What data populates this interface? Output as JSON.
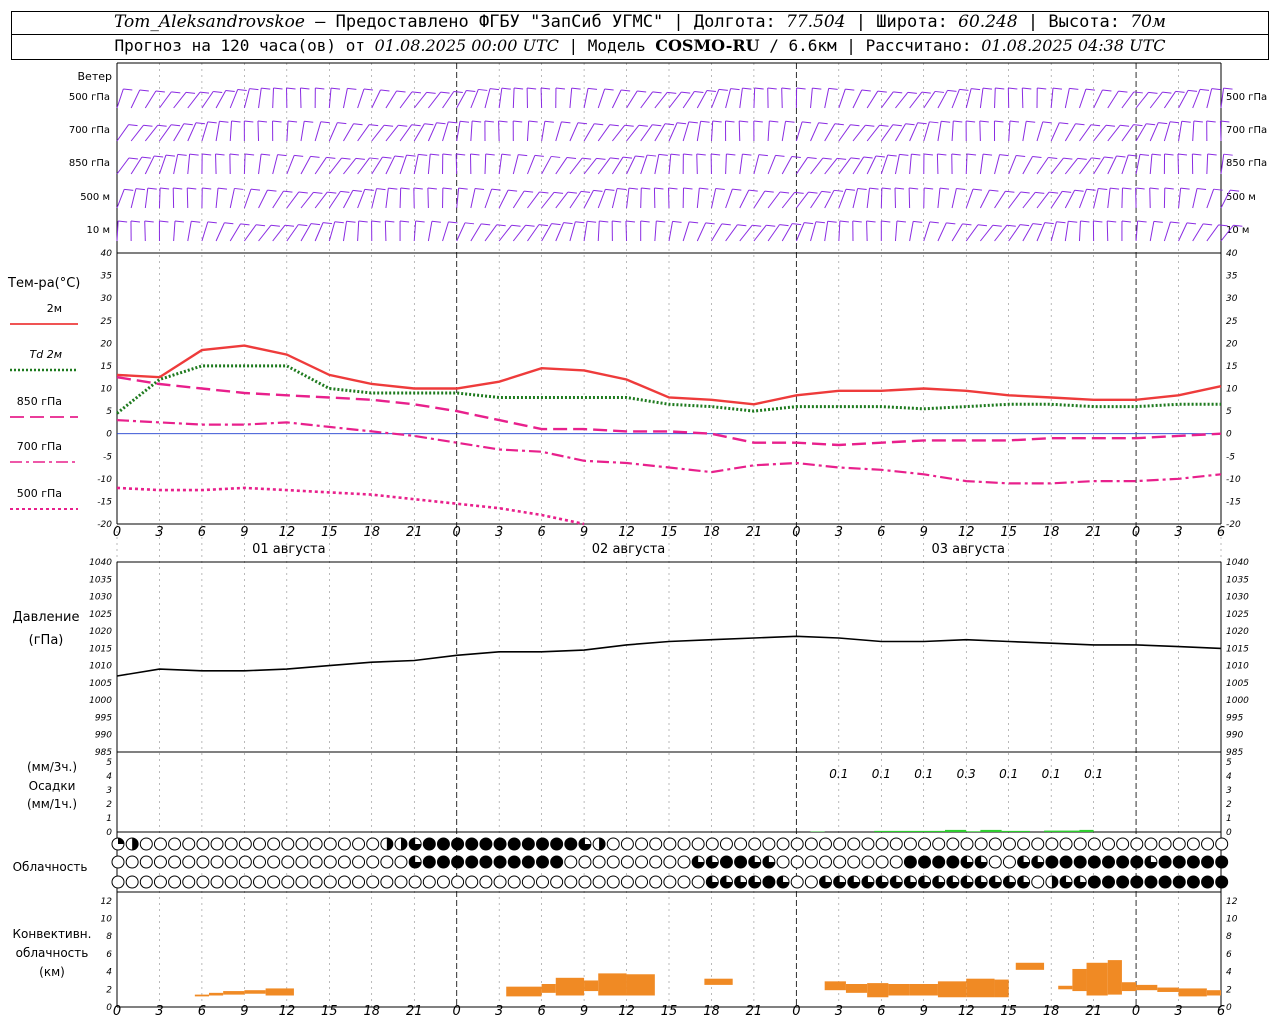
{
  "header": {
    "station": "Tom_Aleksandrovskoe",
    "dash": "—",
    "provider": "Предоставлено ФГБУ \"ЗапСиб УГМС\"",
    "lon_label": "Долгота:",
    "lon_value": "77.504",
    "lat_label": "Широта:",
    "lat_value": "60.248",
    "alt_label": "Высота:",
    "alt_value": "70м",
    "forecast_prefix": "Прогноз на 120 часа(ов) от",
    "forecast_start": "01.08.2025 00:00 UTC",
    "model_label": "Модель",
    "model_name": "COSMO-RU",
    "model_res": "/ 6.6км",
    "computed_label": "Рассчитано:",
    "computed_time": "01.08.2025 04:38 UTC"
  },
  "colors": {
    "wind": "#8a2be2",
    "t2m": "#ee3b3b",
    "td2m": "#1e7a1e",
    "t850": "#e8208c",
    "t700": "#e8208c",
    "t500": "#e8208c",
    "zero_line": "#1f3fcf",
    "pressure": "#000000",
    "precip": "#2ecc2e",
    "convective": "#f08a24",
    "grid": "#000000"
  },
  "x_axis": {
    "hours": [
      "0",
      "3",
      "6",
      "9",
      "12",
      "15",
      "18",
      "21",
      "0",
      "3",
      "6",
      "9",
      "12",
      "15",
      "18",
      "21",
      "0",
      "3",
      "6",
      "9",
      "12",
      "15",
      "18",
      "21",
      "0",
      "3",
      "6"
    ],
    "dates": [
      "01 августа",
      "02 августа",
      "03 августа"
    ]
  },
  "wind_panel": {
    "title": "Ветер",
    "levels": [
      "500 гПа",
      "700 гПа",
      "850 гПа",
      "500 м",
      "10  м"
    ]
  },
  "chart_data": [
    {
      "type": "line",
      "panel": "temperature",
      "title": "Тем-ра(°C)",
      "ylim": [
        -20,
        40
      ],
      "yticks": [
        "40",
        "35",
        "30",
        "25",
        "20",
        "15",
        "10",
        "5",
        "0",
        "-5",
        "-10",
        "-15",
        "-20"
      ],
      "x_hours": [
        0,
        3,
        6,
        9,
        12,
        15,
        18,
        21,
        24,
        27,
        30,
        33,
        36,
        39,
        42,
        45,
        48,
        51,
        54,
        57,
        60,
        63,
        66,
        69,
        72,
        75,
        78
      ],
      "series": [
        {
          "name": "2м",
          "style": "solid",
          "values": [
            13,
            12.5,
            18.5,
            19.5,
            17.5,
            13,
            11,
            10,
            10,
            11.5,
            14.5,
            14,
            12,
            8,
            7.5,
            6.5,
            8.5,
            9.5,
            9.5,
            10,
            9.5,
            8.5,
            8,
            7.5,
            7.5,
            8.5,
            10.5
          ]
        },
        {
          "name": "Td  2м",
          "style": "dotted",
          "values": [
            4.5,
            12,
            15,
            15,
            15,
            10,
            9,
            9,
            9,
            8,
            8,
            8,
            8,
            6.5,
            6,
            5,
            6,
            6,
            6,
            5.5,
            6,
            6.5,
            6.5,
            6,
            6,
            6.5,
            6.5
          ]
        },
        {
          "name": "850  гПа",
          "style": "dash",
          "values": [
            12.5,
            11,
            10,
            9,
            8.5,
            8,
            7.5,
            6.5,
            5,
            3,
            1,
            1,
            0.5,
            0.5,
            0,
            -2,
            -2,
            -2.5,
            -2,
            -1.5,
            -1.5,
            -1.5,
            -1,
            -1,
            -1,
            -0.5,
            0
          ]
        },
        {
          "name": "700  гПа",
          "style": "dashdot",
          "values": [
            3,
            2.5,
            2,
            2,
            2.5,
            1.5,
            0.5,
            -0.5,
            -2,
            -3.5,
            -4,
            -6,
            -6.5,
            -7.5,
            -8.5,
            -7,
            -6.5,
            -7.5,
            -8,
            -9,
            -10.5,
            -11,
            -11,
            -10.5,
            -10.5,
            -10,
            -9
          ]
        },
        {
          "name": "500  гПа",
          "style": "fine-dash",
          "values": [
            -12,
            -12.5,
            -12.5,
            -12,
            -12.5,
            -13,
            -13.5,
            -14.5,
            -15.5,
            -16.5,
            -18,
            -20,
            null,
            null,
            null,
            null,
            null,
            null,
            null,
            null,
            null,
            null,
            null,
            null,
            null,
            null,
            null
          ]
        }
      ]
    },
    {
      "type": "line",
      "panel": "pressure",
      "title": "Давление",
      "ylabel": "(гПа)",
      "ylim": [
        985,
        1040
      ],
      "yticks": [
        "1040",
        "1035",
        "1030",
        "1025",
        "1020",
        "1015",
        "1010",
        "1005",
        "1000",
        "995",
        "990",
        "985"
      ],
      "x_hours": [
        0,
        3,
        6,
        9,
        12,
        15,
        18,
        21,
        24,
        27,
        30,
        33,
        36,
        39,
        42,
        45,
        48,
        51,
        54,
        57,
        60,
        63,
        66,
        69,
        72,
        75,
        78
      ],
      "series": [
        {
          "name": "pressure",
          "values": [
            1007,
            1009,
            1008.5,
            1008.5,
            1009,
            1010,
            1011,
            1011.5,
            1013,
            1014,
            1014,
            1014.5,
            1016,
            1017,
            1017.5,
            1018,
            1018.5,
            1018,
            1017,
            1017,
            1017.5,
            1017,
            1016.5,
            1016,
            1016,
            1015.5,
            1015
          ]
        }
      ]
    },
    {
      "type": "bar",
      "panel": "precipitation",
      "title": "Осадки",
      "ylabel_top": "(мм/3ч.)",
      "ylabel_bottom": "(мм/1ч.)",
      "ylim": [
        0,
        5
      ],
      "yticks": [
        "5",
        "4",
        "3",
        "2",
        "1",
        "0"
      ],
      "labels": [
        {
          "x": 51,
          "text": "0.1"
        },
        {
          "x": 54,
          "text": "0.1"
        },
        {
          "x": 57,
          "text": "0.1"
        },
        {
          "x": 60,
          "text": "0.3"
        },
        {
          "x": 63,
          "text": "0.1"
        },
        {
          "x": 66,
          "text": "0.1"
        },
        {
          "x": 69,
          "text": "0.1"
        }
      ],
      "bars": [
        {
          "x0": 49,
          "x1": 50,
          "value": 0.03
        },
        {
          "x0": 53.5,
          "x1": 58.5,
          "value": 0.08
        },
        {
          "x0": 58.5,
          "x1": 60,
          "value": 0.15
        },
        {
          "x0": 60,
          "x1": 61,
          "value": 0.05
        },
        {
          "x0": 61,
          "x1": 62.5,
          "value": 0.15
        },
        {
          "x0": 62.5,
          "x1": 64.5,
          "value": 0.08
        },
        {
          "x0": 65.5,
          "x1": 68,
          "value": 0.1
        },
        {
          "x0": 68,
          "x1": 69,
          "value": 0.15
        }
      ]
    },
    {
      "type": "table",
      "panel": "cloudiness",
      "title": "Облачность",
      "rows": [
        [
          1,
          2,
          0,
          0,
          0,
          0,
          0,
          0,
          0,
          0,
          0,
          0,
          0,
          0,
          0,
          0,
          0,
          0,
          0,
          2,
          2,
          3,
          4,
          4,
          4,
          4,
          4,
          4,
          4,
          4,
          4,
          4,
          4,
          3,
          2,
          0,
          0,
          0,
          0,
          0,
          0,
          0,
          0,
          0,
          0,
          0,
          0,
          0,
          0,
          0,
          0,
          0,
          0,
          0,
          0,
          0,
          0,
          0,
          0,
          0,
          0,
          0,
          0,
          0,
          0,
          0,
          0,
          0,
          0,
          0,
          0,
          0,
          0,
          0,
          0,
          0,
          0,
          0,
          0
        ],
        [
          0,
          0,
          0,
          0,
          0,
          0,
          0,
          0,
          0,
          0,
          0,
          0,
          0,
          0,
          0,
          0,
          0,
          0,
          0,
          0,
          0,
          3,
          4,
          4,
          4,
          4,
          4,
          4,
          4,
          4,
          4,
          4,
          0,
          0,
          0,
          0,
          0,
          0,
          0,
          0,
          0,
          3,
          3,
          4,
          4,
          3,
          3,
          0,
          0,
          0,
          0,
          0,
          0,
          0,
          0,
          0,
          4,
          4,
          4,
          4,
          3,
          3,
          0,
          0,
          3,
          3,
          4,
          4,
          4,
          4,
          4,
          4,
          4,
          3,
          4,
          4,
          4,
          4,
          4
        ],
        [
          0,
          0,
          0,
          0,
          0,
          0,
          0,
          0,
          0,
          0,
          0,
          0,
          0,
          0,
          0,
          0,
          0,
          0,
          0,
          0,
          0,
          0,
          0,
          0,
          0,
          0,
          0,
          0,
          0,
          0,
          0,
          0,
          0,
          0,
          0,
          0,
          0,
          0,
          0,
          0,
          0,
          0,
          3,
          3,
          3,
          3,
          4,
          3,
          0,
          0,
          3,
          3,
          3,
          3,
          3,
          3,
          3,
          3,
          3,
          3,
          3,
          3,
          3,
          3,
          3,
          0,
          2,
          3,
          3,
          4,
          4,
          4,
          4,
          4,
          4,
          4,
          4,
          4,
          4
        ]
      ]
    },
    {
      "type": "bar",
      "panel": "convective",
      "title": "Конвективн.",
      "subtitle": "облачность",
      "ylabel": "(км)",
      "ylim": [
        0,
        13
      ],
      "yticks": [
        "12",
        "10",
        "8",
        "6",
        "4",
        "2",
        "0"
      ],
      "bars": [
        {
          "x0": 5.5,
          "x1": 6.5,
          "base": 1.2,
          "top": 1.4
        },
        {
          "x0": 6.5,
          "x1": 7.5,
          "base": 1.3,
          "top": 1.6
        },
        {
          "x0": 7.5,
          "x1": 9,
          "base": 1.4,
          "top": 1.8
        },
        {
          "x0": 9,
          "x1": 10.5,
          "base": 1.5,
          "top": 1.9
        },
        {
          "x0": 10.5,
          "x1": 12.5,
          "base": 1.3,
          "top": 2.1
        },
        {
          "x0": 27.5,
          "x1": 30,
          "base": 1.2,
          "top": 2.3
        },
        {
          "x0": 30,
          "x1": 31,
          "base": 1.6,
          "top": 2.6
        },
        {
          "x0": 31,
          "x1": 33,
          "base": 1.3,
          "top": 3.3
        },
        {
          "x0": 33,
          "x1": 34,
          "base": 1.8,
          "top": 3.0
        },
        {
          "x0": 34,
          "x1": 36,
          "base": 1.3,
          "top": 3.8
        },
        {
          "x0": 36,
          "x1": 38,
          "base": 1.3,
          "top": 3.7
        },
        {
          "x0": 41.5,
          "x1": 43.5,
          "base": 2.5,
          "top": 3.2
        },
        {
          "x0": 50,
          "x1": 51.5,
          "base": 1.9,
          "top": 2.9
        },
        {
          "x0": 51.5,
          "x1": 53,
          "base": 1.6,
          "top": 2.6
        },
        {
          "x0": 53,
          "x1": 54.5,
          "base": 1.1,
          "top": 2.7
        },
        {
          "x0": 54.5,
          "x1": 56,
          "base": 1.3,
          "top": 2.6
        },
        {
          "x0": 56,
          "x1": 58,
          "base": 1.3,
          "top": 2.6
        },
        {
          "x0": 58,
          "x1": 60,
          "base": 1.1,
          "top": 2.9
        },
        {
          "x0": 60,
          "x1": 62,
          "base": 1.1,
          "top": 3.2
        },
        {
          "x0": 62,
          "x1": 63,
          "base": 1.1,
          "top": 3.1
        },
        {
          "x0": 63.5,
          "x1": 65.5,
          "base": 4.2,
          "top": 5.0
        },
        {
          "x0": 66.5,
          "x1": 67.5,
          "base": 2.0,
          "top": 2.4
        },
        {
          "x0": 67.5,
          "x1": 68.5,
          "base": 1.8,
          "top": 4.3
        },
        {
          "x0": 68.5,
          "x1": 70,
          "base": 1.3,
          "top": 5.0
        },
        {
          "x0": 70,
          "x1": 71,
          "base": 1.4,
          "top": 5.3
        },
        {
          "x0": 71,
          "x1": 72,
          "base": 1.8,
          "top": 2.8
        },
        {
          "x0": 72,
          "x1": 73.5,
          "base": 1.9,
          "top": 2.5
        },
        {
          "x0": 73.5,
          "x1": 75,
          "base": 1.7,
          "top": 2.2
        },
        {
          "x0": 75,
          "x1": 77,
          "base": 1.2,
          "top": 2.1
        },
        {
          "x0": 77,
          "x1": 78,
          "base": 1.3,
          "top": 1.9
        }
      ]
    }
  ]
}
